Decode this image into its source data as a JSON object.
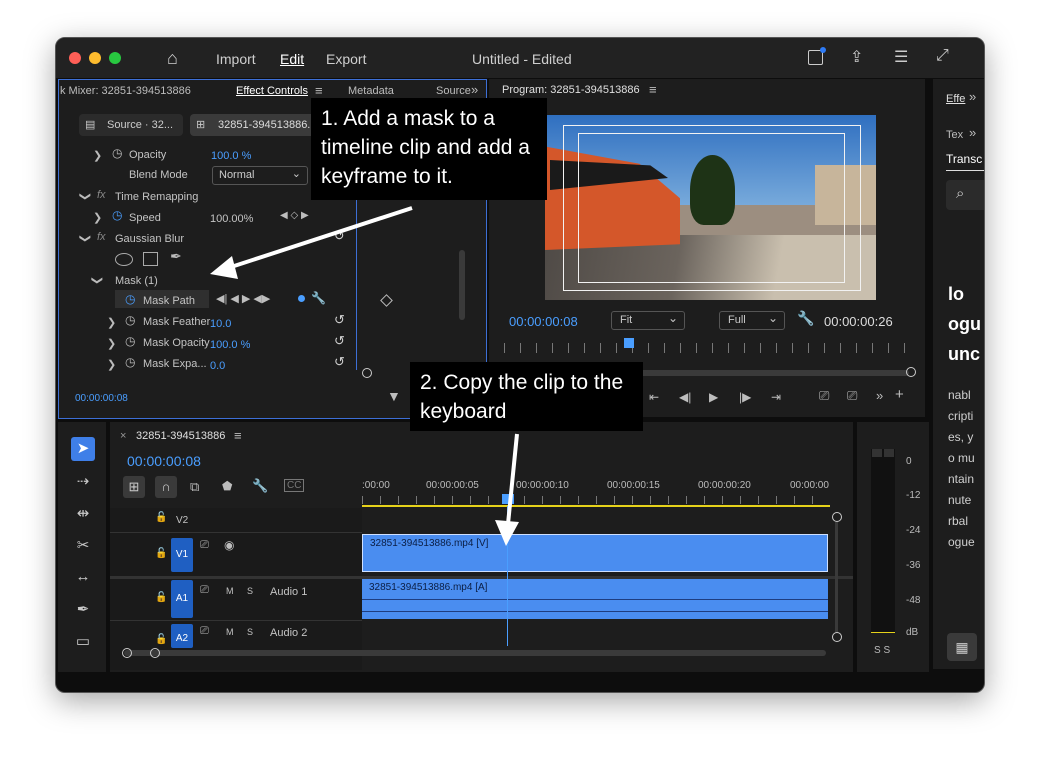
{
  "app": {
    "nav": {
      "import": "Import",
      "edit": "Edit",
      "export": "Export"
    },
    "title": "Untitled - Edited"
  },
  "effect_panel": {
    "tabs": {
      "mixer": "k Mixer: 32851-394513886",
      "effect_controls": "Effect Controls",
      "metadata": "Metadata",
      "source": "Source"
    },
    "source_dropdown": "Source · 32...",
    "clip_dropdown": "32851-394513886...",
    "rows": {
      "opacity": "Opacity",
      "opacity_val": "100.0 %",
      "blend_mode": "Blend Mode",
      "blend_val": "Normal",
      "time_remap": "Time Remapping",
      "speed": "Speed",
      "speed_val": "100.00%",
      "gaussian": "Gaussian Blur",
      "mask": "Mask (1)",
      "mask_path": "Mask Path",
      "mask_feather": "Mask Feather",
      "mask_feather_val": "10.0",
      "mask_opacity": "Mask Opacity",
      "mask_opacity_val": "100.0 %",
      "mask_expansion": "Mask Expa...",
      "mask_expansion_val": "0.0"
    },
    "timecode": "00:00:00:08"
  },
  "program_panel": {
    "title": "Program: 32851-394513886",
    "timecode_left": "00:00:00:08",
    "fit": "Fit",
    "full": "Full",
    "timecode_right": "00:00:00:26"
  },
  "side_panel": {
    "tab1": "Effe",
    "tab2": "Tex",
    "transcript": "Transc",
    "text_lines": [
      "lo",
      "ogu",
      "unc"
    ],
    "small_lines": [
      "nabl",
      "cripti",
      "es, y",
      "o mu",
      "ntain",
      "nute",
      "rbal",
      "ogue"
    ]
  },
  "timeline": {
    "sequence_name": "32851-394513886",
    "timecode": "00:00:00:08",
    "ruler": [
      ":00:00",
      "00:00:00:05",
      "00:00:00:10",
      "00:00:00:15",
      "00:00:00:20",
      "00:00:00"
    ],
    "tracks": {
      "v2": "V2",
      "v1": "V1",
      "a1": "A1",
      "a2": "A2",
      "audio1": "Audio 1",
      "audio2": "Audio 2",
      "m": "M",
      "s": "S"
    },
    "clips": {
      "video": "32851-394513886.mp4 [V]",
      "audio": "32851-394513886.mp4 [A]"
    }
  },
  "meter": {
    "labels": [
      "0",
      "-12",
      "-24",
      "-36",
      "-48",
      "dB"
    ],
    "solo": "S S"
  },
  "callouts": {
    "one": "1. Add a mask to a timeline clip and add a keyframe to it.",
    "two": "2. Copy the clip to the keyboard"
  },
  "colors": {
    "accent": "#4a9eff",
    "clip": "#4a8df0",
    "track_button": "#1f5fc2"
  }
}
